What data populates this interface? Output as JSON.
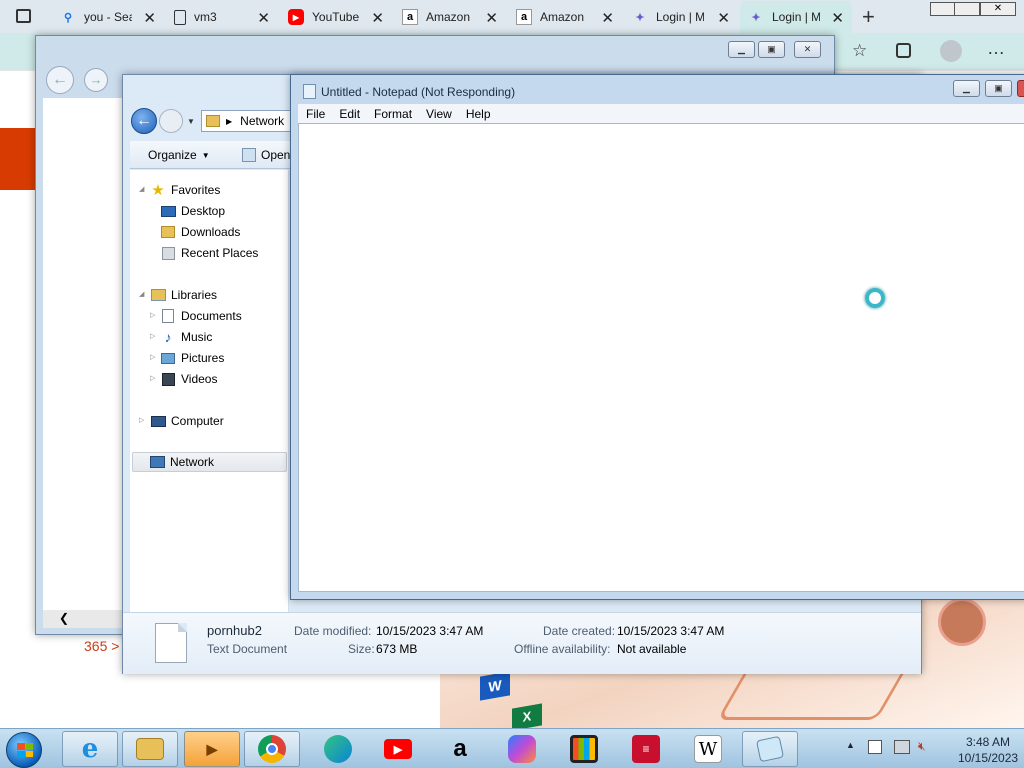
{
  "browser": {
    "tabs": [
      {
        "label": "you - Sea",
        "icon": "search-icon",
        "active": false
      },
      {
        "label": "vm3",
        "icon": "document-icon",
        "active": false
      },
      {
        "label": "YouTube",
        "icon": "youtube-icon",
        "active": false
      },
      {
        "label": "Amazon",
        "icon": "amazon-icon",
        "active": false
      },
      {
        "label": "Amazon",
        "icon": "amazon-icon",
        "active": false
      },
      {
        "label": "Login | M",
        "icon": "microsoft-icon",
        "active": false
      },
      {
        "label": "Login | M",
        "icon": "microsoft-icon",
        "active": true
      }
    ],
    "close_glyph": "✕",
    "new_tab_glyph": "+",
    "promo_text": "365 >",
    "toolbar_more": "…"
  },
  "explorer": {
    "address": "Network",
    "commands": {
      "organize": "Organize",
      "open": "Open"
    },
    "nav": {
      "favorites": "Favorites",
      "desktop": "Desktop",
      "downloads": "Downloads",
      "recent": "Recent Places",
      "libraries": "Libraries",
      "documents": "Documents",
      "music": "Music",
      "pictures": "Pictures",
      "videos": "Videos",
      "computer": "Computer",
      "network": "Network"
    },
    "details": {
      "file_name": "pornhub2",
      "file_type": "Text Document",
      "date_modified_label": "Date modified:",
      "date_modified": "10/15/2023 3:47 AM",
      "size_label": "Size:",
      "size": "673 MB",
      "date_created_label": "Date created:",
      "date_created": "10/15/2023 3:47 AM",
      "offline_label": "Offline availability:",
      "offline": "Not available"
    }
  },
  "notepad": {
    "title": "Untitled - Notepad (Not Responding)",
    "menu": [
      "File",
      "Edit",
      "Format",
      "View",
      "Help"
    ]
  },
  "taskbar": {
    "time": "3:48 AM",
    "date": "10/15/2023",
    "apps": [
      "internet-explorer",
      "file-explorer",
      "media-player",
      "chrome",
      "edge",
      "youtube",
      "amazon",
      "copilot",
      "store",
      "bank-of-america",
      "wikipedia",
      "notepad"
    ]
  }
}
